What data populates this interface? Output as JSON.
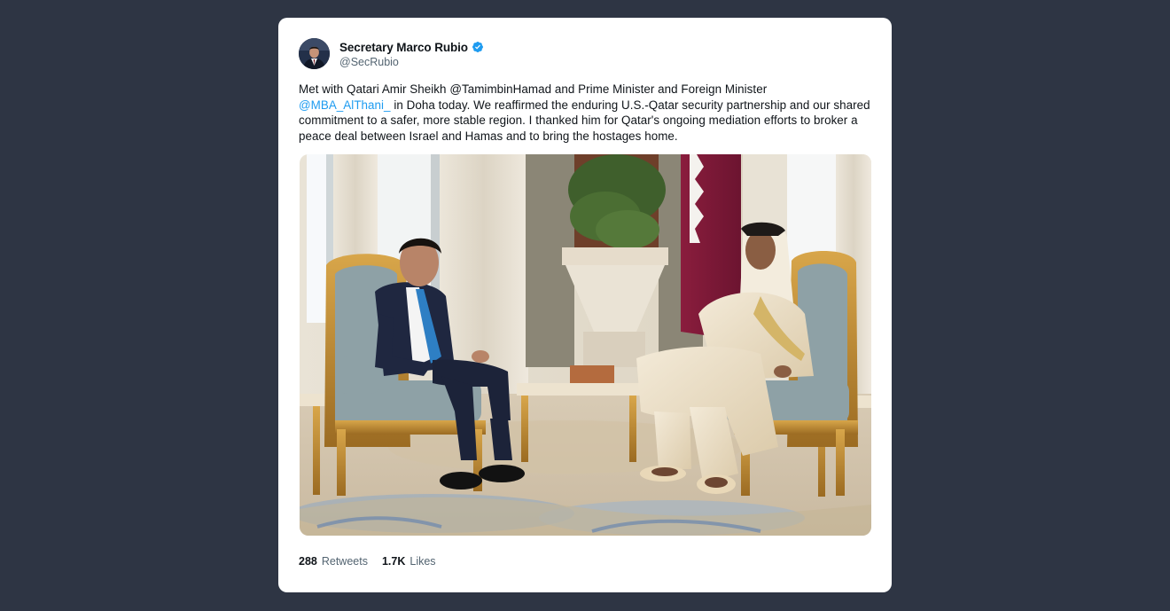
{
  "tweet": {
    "author": {
      "display_name": "Secretary Marco Rubio",
      "handle": "@SecRubio",
      "verified": true
    },
    "text_parts": {
      "line1": "Met with Qatari Amir Sheikh @TamimbinHamad and Prime Minister and Foreign Minister",
      "mention": "@MBA_AlThani_",
      "rest": " in Doha today. We reaffirmed the enduring U.S.-Qatar security partnership and our shared commitment to a safer, more stable region. I thanked him for Qatar's ongoing mediation efforts to broker a peace deal between Israel and Hamas and to bring the hostages home."
    },
    "stats": {
      "retweets_count": "288",
      "retweets_label": "Retweets",
      "likes_count": "1.7K",
      "likes_label": "Likes"
    }
  },
  "colors": {
    "background": "#2e3544",
    "card": "#ffffff",
    "link": "#1d9bf0",
    "verified_badge": "#1d9bf0",
    "text_primary": "#0f1419",
    "text_secondary": "#536471"
  },
  "icons": {
    "verified": "verified-badge-icon"
  }
}
